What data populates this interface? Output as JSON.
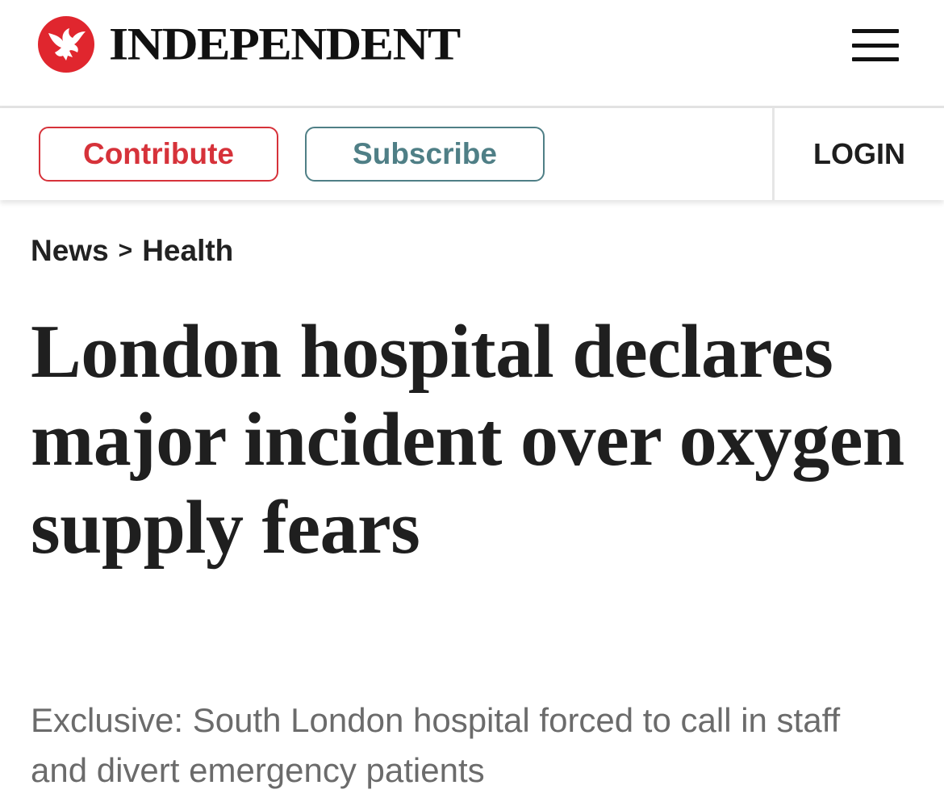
{
  "header": {
    "brand": "INDEPENDENT",
    "logo_icon": "eagle-icon",
    "menu_icon": "hamburger-menu-icon"
  },
  "actions": {
    "contribute_label": "Contribute",
    "subscribe_label": "Subscribe",
    "login_label": "LOGIN"
  },
  "breadcrumb": {
    "items": [
      "News",
      "Health"
    ],
    "separator": ">"
  },
  "article": {
    "headline": "London hospital declares major incident over oxygen supply fears",
    "standfirst": "Exclusive: South London hospital forced to call in staff and divert emergency patients"
  },
  "colors": {
    "brand_red": "#e0262e",
    "contribute": "#d6323a",
    "subscribe": "#4f7f86",
    "text": "#1e1e1e",
    "standfirst": "#6b6b6b"
  }
}
